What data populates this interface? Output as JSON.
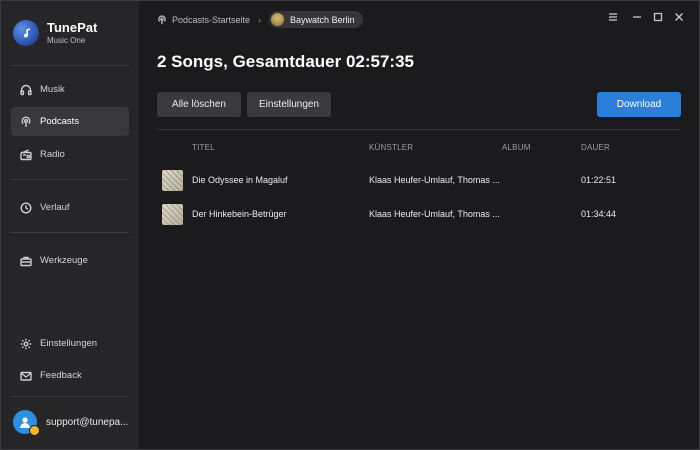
{
  "brand": {
    "name": "TunePat",
    "subtitle": "Music One"
  },
  "sidebar": {
    "items": [
      {
        "label": "Musik",
        "icon": "headphones-icon"
      },
      {
        "label": "Podcasts",
        "icon": "podcast-icon",
        "active": true
      },
      {
        "label": "Radio",
        "icon": "radio-icon"
      },
      {
        "label": "Verlauf",
        "icon": "clock-icon"
      },
      {
        "label": "Werkzeuge",
        "icon": "toolbox-icon"
      },
      {
        "label": "Einstellungen",
        "icon": "gear-icon"
      },
      {
        "label": "Feedback",
        "icon": "mail-icon"
      }
    ],
    "user": {
      "email": "support@tunepa..."
    }
  },
  "breadcrumb": {
    "home": "Podcasts-Startseite",
    "current": "Baywatch Berlin"
  },
  "main": {
    "title": "2 Songs, Gesamtdauer 02:57:35",
    "buttons": {
      "clear_all": "Alle löschen",
      "settings": "Einstellungen",
      "download": "Download"
    },
    "table": {
      "headers": {
        "title": "TITEL",
        "artist": "KÜNSTLER",
        "album": "ALBUM",
        "duration": "DAUER"
      },
      "rows": [
        {
          "title": "Die Odyssee in Magaluf",
          "artist": "Klaas Heufer-Umlauf, Thomas ...",
          "album": "",
          "duration": "01:22:51"
        },
        {
          "title": "Der Hinkebein-Betrüger",
          "artist": "Klaas Heufer-Umlauf, Thomas ...",
          "album": "",
          "duration": "01:34:44"
        }
      ]
    }
  },
  "colors": {
    "accent": "#2c7fd8",
    "background": "#1b1b1e",
    "sidebar": "#262629"
  }
}
